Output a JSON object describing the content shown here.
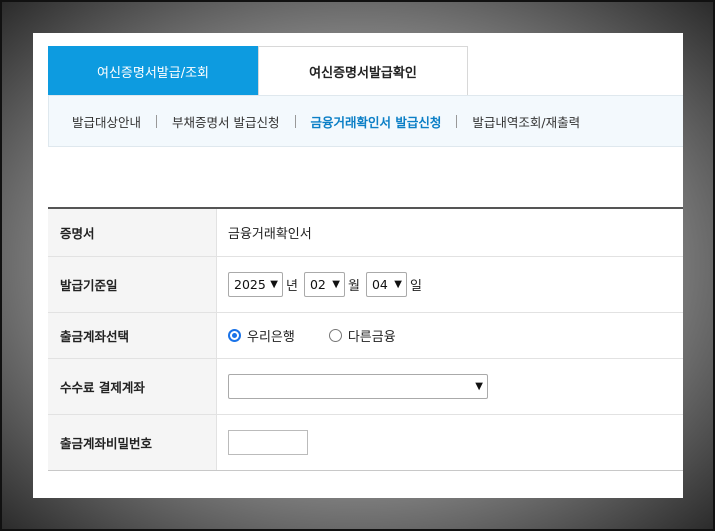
{
  "tabs": [
    {
      "label": "여신증명서발급/조회",
      "active": true
    },
    {
      "label": "여신증명서발급확인",
      "active": false
    }
  ],
  "subnav": [
    {
      "label": "발급대상안내"
    },
    {
      "label": "부채증명서 발급신청"
    },
    {
      "label": "금융거래확인서 발급신청",
      "current": true
    },
    {
      "label": "발급내역조회/재출력"
    }
  ],
  "form": {
    "certificate": {
      "label": "증명서",
      "value": "금융거래확인서"
    },
    "issue_date": {
      "label": "발급기준일",
      "year": "2025",
      "year_unit": "년",
      "month": "02",
      "month_unit": "월",
      "day": "04",
      "day_unit": "일"
    },
    "account_select": {
      "label": "출금계좌선택",
      "options": [
        {
          "label": "우리은행",
          "selected": true
        },
        {
          "label": "다른금융",
          "selected": false
        }
      ]
    },
    "fee_account": {
      "label": "수수료 결제계좌",
      "value": ""
    },
    "password": {
      "label": "출금계좌비밀번호",
      "value": ""
    }
  },
  "colors": {
    "accent": "#0d9be0",
    "active_link": "#0b7fc6",
    "radio": "#1a73e8"
  }
}
